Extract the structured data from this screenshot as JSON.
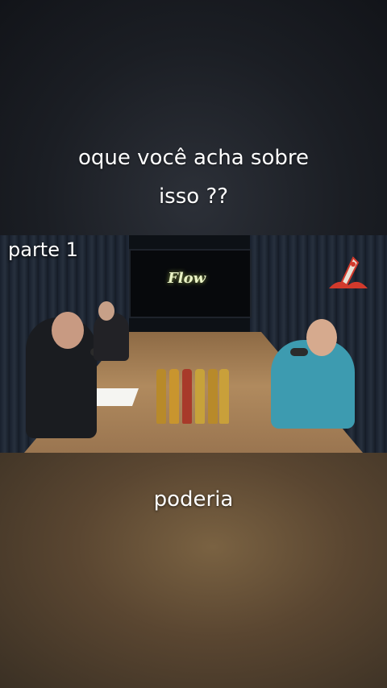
{
  "caption_top": {
    "line1": "oque você acha sobre",
    "line2": "isso ??"
  },
  "video": {
    "overlay_label": "parte 1",
    "screen_logo_text": "Flow"
  },
  "caption_bottom": "poderia",
  "colors": {
    "caption_text": "#ffffff",
    "top_background": "#1b1e24",
    "bottom_background": "#5a4631"
  }
}
